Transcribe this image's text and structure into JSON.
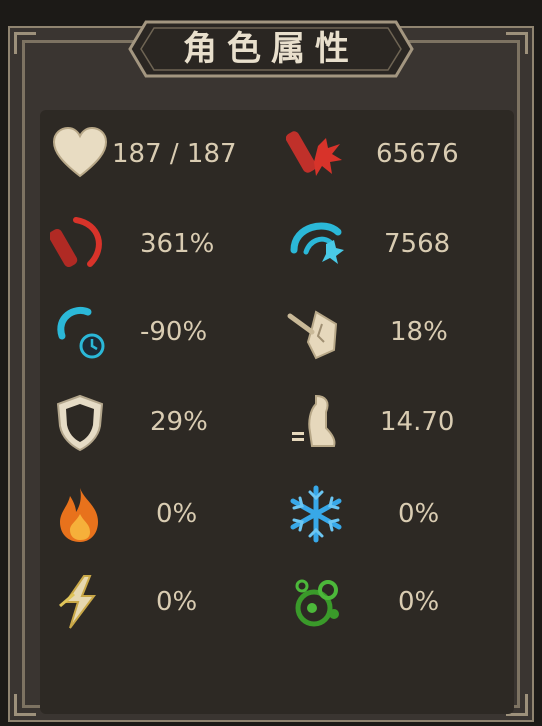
{
  "title": "角色属性",
  "stats": [
    {
      "icon": "heart-icon",
      "value": "187 / 187"
    },
    {
      "icon": "attack-power-icon",
      "value": "65676"
    },
    {
      "icon": "attack-bonus-icon",
      "value": "361%"
    },
    {
      "icon": "critical-strike-icon",
      "value": "7568"
    },
    {
      "icon": "cooldown-icon",
      "value": "-90%"
    },
    {
      "icon": "dodge-icon",
      "value": "18%"
    },
    {
      "icon": "shield-icon",
      "value": "29%"
    },
    {
      "icon": "movement-speed-icon",
      "value": "14.70"
    },
    {
      "icon": "fire-resistance-icon",
      "value": "0%"
    },
    {
      "icon": "ice-resistance-icon",
      "value": "0%"
    },
    {
      "icon": "lightning-resistance-icon",
      "value": "0%"
    },
    {
      "icon": "poison-resistance-icon",
      "value": "0%"
    }
  ],
  "colors": {
    "panel": "#3a3531",
    "text": "#d9ccb2",
    "fire": "#e8721c",
    "ice": "#38a8e8",
    "poison": "#3a9a2a",
    "red": "#c0302a",
    "cyan": "#2bb8d8"
  }
}
